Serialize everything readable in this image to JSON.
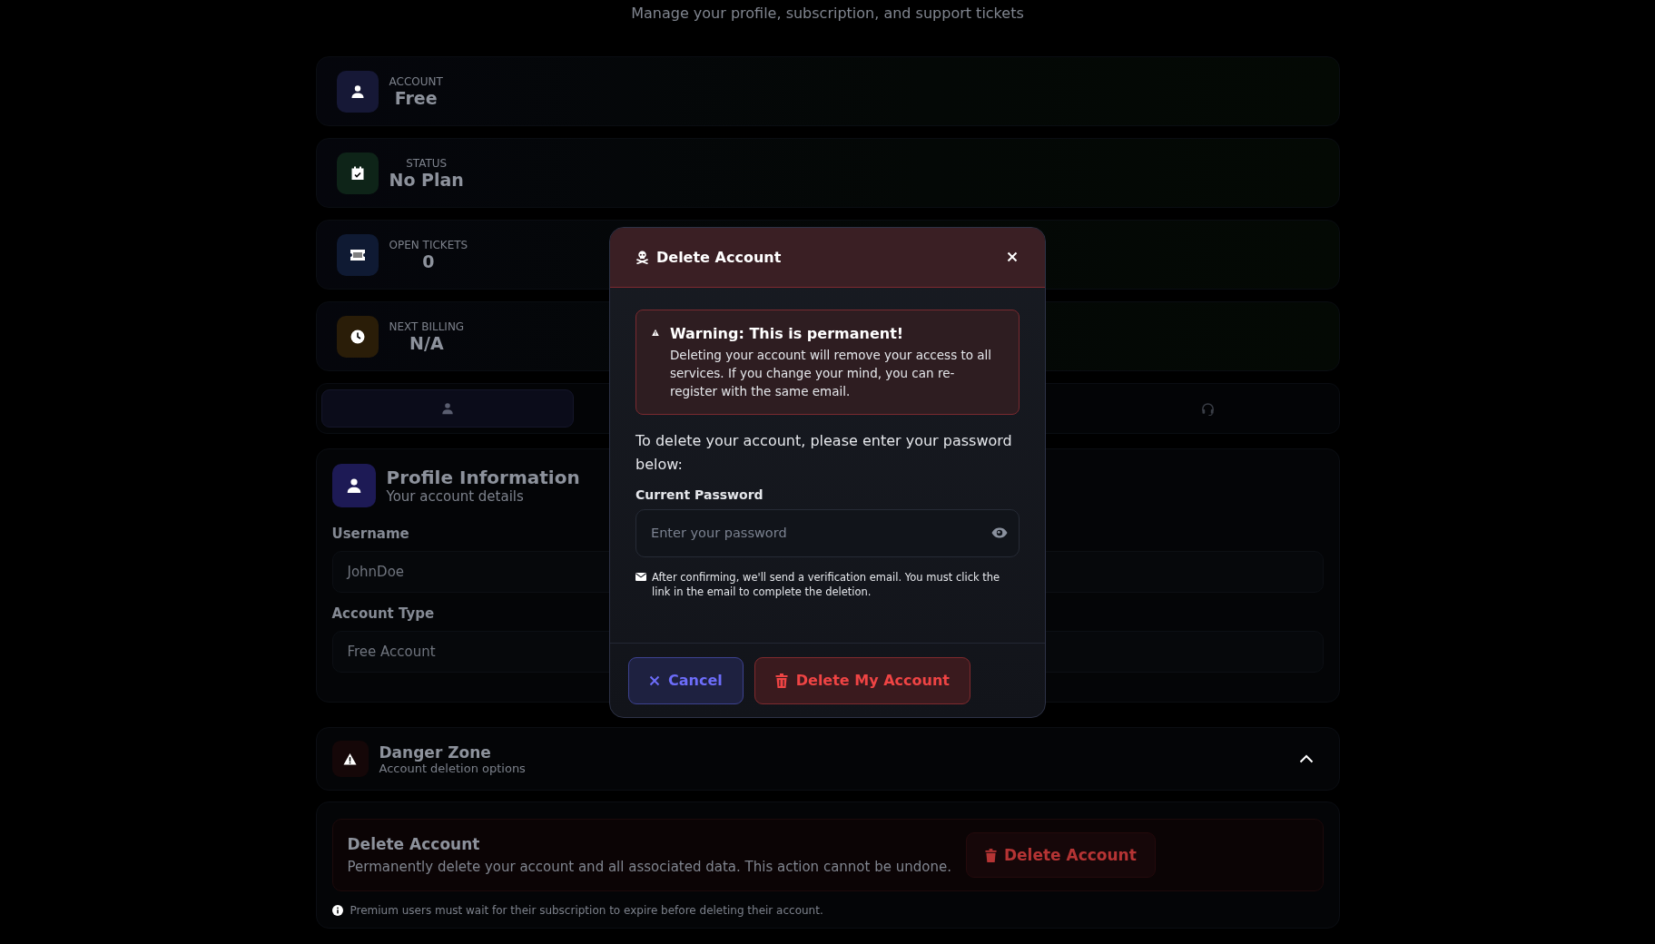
{
  "header": {
    "subtitle": "Manage your profile, subscription, and support tickets"
  },
  "stats": [
    {
      "kind": "account",
      "label": "ACCOUNT",
      "value": "Free",
      "color": "#161836"
    },
    {
      "kind": "status",
      "label": "STATUS",
      "value": "No Plan",
      "color": "#0e2418"
    },
    {
      "kind": "tickets",
      "label": "OPEN TICKETS",
      "value": "0",
      "color": "#0f1a33"
    },
    {
      "kind": "billing",
      "label": "NEXT BILLING",
      "value": "N/A",
      "color": "#2a1d08"
    }
  ],
  "tabs": [
    {
      "kind": "profile",
      "selected": true
    },
    {
      "kind": "support",
      "selected": false
    }
  ],
  "profile": {
    "title": "Profile Information",
    "subtitle": "Your account details",
    "fields": [
      {
        "label": "Username",
        "value": "JohnDoe"
      },
      {
        "label": "Account Type",
        "value": "Free Account"
      }
    ]
  },
  "danger_zone": {
    "title": "Danger Zone",
    "subtitle": "Account deletion options",
    "expanded": true,
    "card_title": "Delete Account",
    "card_text": "Permanently delete your account and all associated data. This action cannot be undone.",
    "button": "Delete Account",
    "note": "Premium users must wait for their subscription to expire before deleting their account."
  },
  "modal": {
    "title": "Delete Account",
    "warning_title": "Warning: This is permanent!",
    "warning_text": "Deleting your account will remove your access to all services. If you change your mind, you can re-register with the same email.",
    "prompt": "To delete your account, please enter your password below:",
    "password_label": "Current Password",
    "password_placeholder": "Enter your password",
    "notice": "After confirming, we'll send a verification email. You must click the link in the email to complete the deletion.",
    "cancel": "Cancel",
    "confirm": "Delete My Account"
  }
}
